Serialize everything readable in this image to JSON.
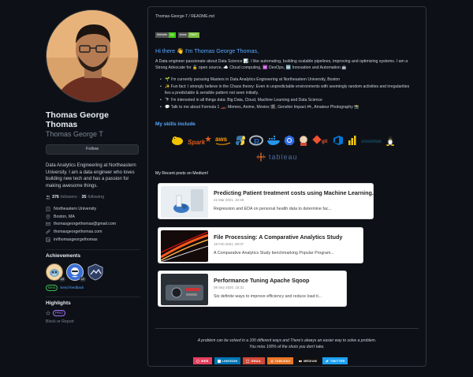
{
  "profile": {
    "full_name": "Thomas George Thomas",
    "username": "Thomas George T",
    "follow_label": "Follow",
    "bio": "Data Analytics Engineering at Northeastern University. I am a data engineer who loves building new tech and has a passion for making awesome things.",
    "followers_count": "376",
    "followers_label": "followers",
    "following_count": "35",
    "following_label": "following",
    "organization": "Northeastern University",
    "location": "Boston, MA",
    "email": "thomasgeorgethomas@gmail.com",
    "website": "thomasgeorgethomas.com",
    "linkedin": "in/thomasgeorgethomas"
  },
  "achievements": {
    "title": "Achievements",
    "badges": [
      {
        "name": "pull-shark",
        "count": "x3"
      },
      {
        "name": "yolo",
        "count": "x2"
      },
      {
        "name": "arctic-code-vault",
        "count": ""
      }
    ],
    "beta_label": "Beta",
    "feedback_label": "Send feedback"
  },
  "highlights": {
    "title": "Highlights",
    "pro_label": "PRO",
    "block_label": "Block or Report"
  },
  "readme": {
    "path": "Thomas-George-T / README.md",
    "shields": [
      {
        "left": "Website",
        "right": "Up"
      },
      {
        "left": "views",
        "right": "29827"
      }
    ],
    "hello": "Hi there 👋 I'm Thomas George Thomas,",
    "intro": "A Data engineer passionate about Data Science 📊. I like automating, building scalable pipelines, improving and optimizing systems. I am a Strong Advocate for 🔓 open source, ☁️ Cloud computing, ♾️ DevOps, 🆕 Innovation and Automation 🤖",
    "bullets": [
      "🌱 I'm currently pursuing Masters in Data Analytics Engineering at Northeastern University, Boston",
      "✨ Fun fact: I strongly believe in the Chaos theory: Even in unpredictable environments with seemingly random activities and irregularities lies a predictable & sensible pattern not seen initially.",
      "🔭 I'm interested in all things data: Big Data, Cloud, Machine Learning and Data Science",
      "💬 Talk to me about Formula 1 🏎️, Memes, Anime, Movies 🎬, Genshin Impact 🎮, Amateur Photography 📸"
    ],
    "skills_title": "My skills include",
    "skills": [
      {
        "name": "Hadoop",
        "color": "#f2c200"
      },
      {
        "name": "Spark",
        "color": "#e25a1c"
      },
      {
        "name": "aws",
        "color": "#ff9900"
      },
      {
        "name": "Python",
        "color": "#3776ab"
      },
      {
        "name": "R",
        "color": "#276dc3"
      },
      {
        "name": "Docker",
        "color": "#2496ed"
      },
      {
        "name": "Kubernetes",
        "color": "#326ce5"
      },
      {
        "name": "Jenkins",
        "color": "#d24939"
      },
      {
        "name": "git",
        "color": "#f05032"
      },
      {
        "name": "Azure DevOps",
        "color": "#0078d7"
      },
      {
        "name": "Power BI",
        "color": "#f2c811"
      },
      {
        "name": "Snowflake",
        "color": "#29b5e8"
      },
      {
        "name": "Linux",
        "color": "#fcc624"
      }
    ],
    "tableau_label": "tableau",
    "recent_title": "My Recent posts on Medium!",
    "posts": [
      {
        "title": "Predicting Patient treatment costs using Machine Learning.",
        "date": "21 Mar 2021, 10:48",
        "desc": "Regression and EDA on personal health data to determine fac..."
      },
      {
        "title": "File Processing: A Comparative Analytics Study",
        "date": "19 Feb 2021, 00:07",
        "desc": "A Comparative Analytics Study benchmarking Popular Program..."
      },
      {
        "title": "Performance Tuning Apache Sqoop",
        "date": "08 Sep 2020, 15:31",
        "desc": "Six definite ways to improve efficiency and reduce load ti..."
      }
    ],
    "quote_line1": "A problem can be solved in a 100 different ways and There's always an easier way to solve a problem.",
    "quote_line2": "You miss 100% of the shots you don't take.",
    "socials": [
      {
        "label": "WEB",
        "color": "#e4405f"
      },
      {
        "label": "LINKEDIN",
        "color": "#0077b5"
      },
      {
        "label": "GMAIL",
        "color": "#d14836"
      },
      {
        "label": "TABLEAU",
        "color": "#e97627"
      },
      {
        "label": "MEDIUM",
        "color": "#12100e"
      },
      {
        "label": "TWITTER",
        "color": "#1ca0f2"
      }
    ]
  }
}
